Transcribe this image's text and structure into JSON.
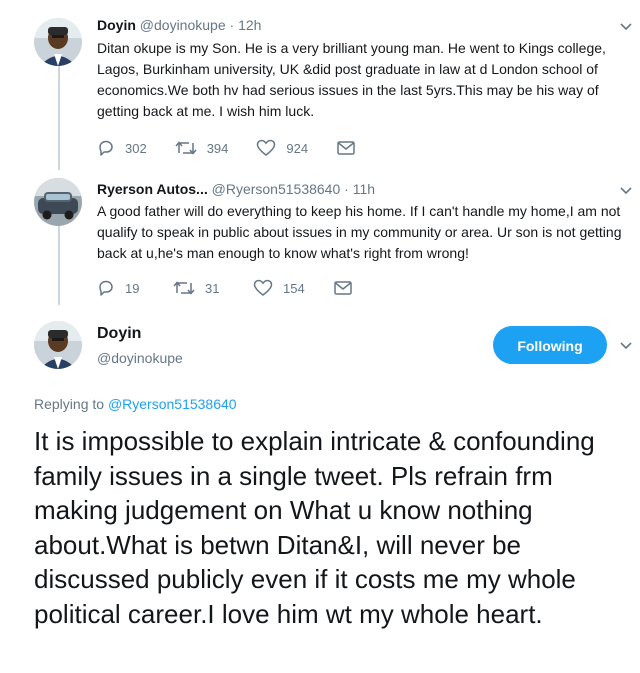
{
  "tweets": [
    {
      "display_name": "Doyin",
      "handle": "@doyinokupe",
      "separator": "·",
      "time": "12h",
      "text": "Ditan okupe is my Son. He is a very brilliant young man. He went to Kings college, Lagos, Burkinham university, UK &did post graduate in law at d London school of economics.We both hv had serious issues in the last 5yrs.This may be his way of getting back at me. I wish him luck.",
      "replies": "302",
      "retweets": "394",
      "likes": "924"
    },
    {
      "display_name": "Ryerson Autos...",
      "handle": "@Ryerson51538640",
      "separator": "·",
      "time": "11h",
      "text": "A good father will do everything to keep his home. If I can't handle my home,I am not qualify to speak in public about issues in my community or area. Ur son is not getting back at u,he's man enough to know what's right from wrong!",
      "replies": "19",
      "retweets": "31",
      "likes": "154"
    }
  ],
  "main_tweet": {
    "display_name": "Doyin",
    "handle": "@doyinokupe",
    "follow_label": "Following",
    "replying_prefix": "Replying to",
    "replying_to": "@Ryerson51538640",
    "text": "It is impossible to explain intricate & confounding family issues in a single tweet. Pls refrain frm making judgement on What u know nothing about.What is betwn Ditan&I, will never be discussed publicly even if it costs me my whole political career.I love him wt my whole heart."
  },
  "colors": {
    "accent": "#1da1f2",
    "secondary_text": "#657786",
    "primary_text": "#14171a",
    "thread_line": "#ccd6dd"
  },
  "icons": [
    "avatar-doyin",
    "avatar-ryerson-autos",
    "reply-icon",
    "retweet-icon",
    "like-icon",
    "message-icon",
    "chevron-down-icon"
  ]
}
